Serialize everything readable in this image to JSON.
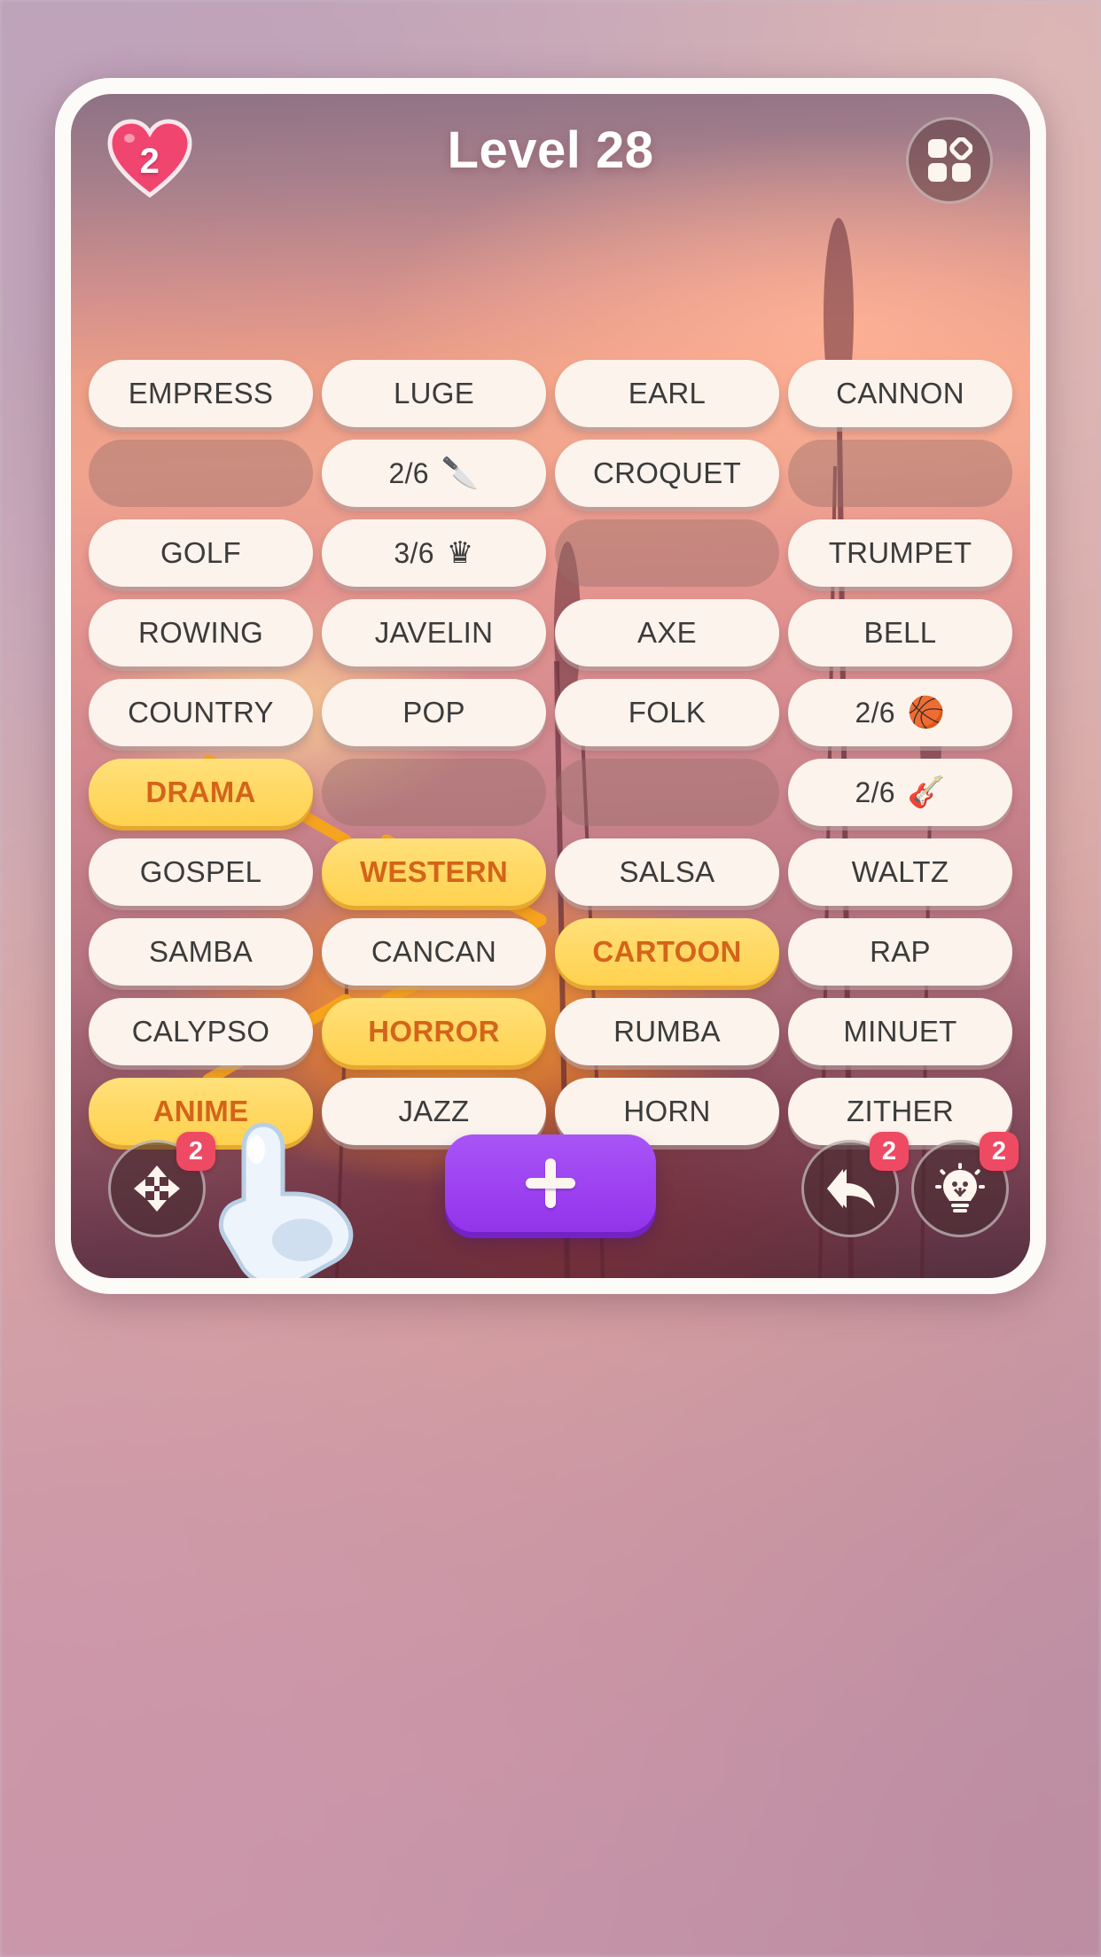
{
  "header": {
    "lives_icon": "heart-icon",
    "lives_count": "2",
    "title": "Level 28",
    "menu_icon": "grid-menu-icon"
  },
  "colors": {
    "selected_tile_bg": "#ffd24f",
    "selected_tile_text": "#d4641a",
    "tile_bg": "#fbf3ec",
    "tile_text": "#3b3b3b",
    "badge": "#ef4a63",
    "heart": "#f0456f",
    "add_button": "#9333ea",
    "link_line": "#f9a51a"
  },
  "grid": {
    "columns": 4,
    "rows": 10,
    "tiles": [
      {
        "label": "EMPRESS",
        "state": "normal"
      },
      {
        "label": "LUGE",
        "state": "normal"
      },
      {
        "label": "EARL",
        "state": "normal"
      },
      {
        "label": "CANNON",
        "state": "normal"
      },
      {
        "label": "",
        "state": "empty"
      },
      {
        "label": "2/6",
        "state": "progress",
        "icon": "knife-icon",
        "glyph": "🔪"
      },
      {
        "label": "CROQUET",
        "state": "normal"
      },
      {
        "label": "",
        "state": "empty"
      },
      {
        "label": "GOLF",
        "state": "normal"
      },
      {
        "label": "3/6",
        "state": "progress",
        "icon": "crown-icon",
        "glyph": "♛"
      },
      {
        "label": "",
        "state": "empty"
      },
      {
        "label": "TRUMPET",
        "state": "normal"
      },
      {
        "label": "ROWING",
        "state": "normal"
      },
      {
        "label": "JAVELIN",
        "state": "normal"
      },
      {
        "label": "AXE",
        "state": "normal"
      },
      {
        "label": "BELL",
        "state": "normal"
      },
      {
        "label": "COUNTRY",
        "state": "normal"
      },
      {
        "label": "POP",
        "state": "normal"
      },
      {
        "label": "FOLK",
        "state": "normal"
      },
      {
        "label": "2/6",
        "state": "progress",
        "icon": "basketball-icon",
        "glyph": "🏀"
      },
      {
        "label": "DRAMA",
        "state": "selected"
      },
      {
        "label": "",
        "state": "empty"
      },
      {
        "label": "",
        "state": "empty"
      },
      {
        "label": "2/6",
        "state": "progress",
        "icon": "guitar-icon",
        "glyph": "🎸"
      },
      {
        "label": "GOSPEL",
        "state": "normal"
      },
      {
        "label": "WESTERN",
        "state": "selected"
      },
      {
        "label": "SALSA",
        "state": "normal"
      },
      {
        "label": "WALTZ",
        "state": "normal"
      },
      {
        "label": "SAMBA",
        "state": "normal"
      },
      {
        "label": "CANCAN",
        "state": "normal"
      },
      {
        "label": "CARTOON",
        "state": "selected"
      },
      {
        "label": "RAP",
        "state": "normal"
      },
      {
        "label": "CALYPSO",
        "state": "normal"
      },
      {
        "label": "HORROR",
        "state": "selected"
      },
      {
        "label": "RUMBA",
        "state": "normal"
      },
      {
        "label": "MINUET",
        "state": "normal"
      },
      {
        "label": "ANIME",
        "state": "selected"
      },
      {
        "label": "JAZZ",
        "state": "normal"
      },
      {
        "label": "HORN",
        "state": "normal"
      },
      {
        "label": "ZITHER",
        "state": "normal"
      }
    ],
    "selection_path": [
      "DRAMA",
      "WESTERN",
      "CARTOON",
      "HORROR",
      "ANIME"
    ]
  },
  "bottom_bar": {
    "shuffle": {
      "icon": "move-arrows-icon",
      "badge": "2"
    },
    "add": {
      "icon": "plus-icon",
      "label": "+"
    },
    "undo": {
      "icon": "undo-arrow-icon",
      "badge": "2"
    },
    "hint": {
      "icon": "lightbulb-icon",
      "badge": "2"
    }
  },
  "cursor": {
    "icon": "pointing-hand-icon"
  }
}
